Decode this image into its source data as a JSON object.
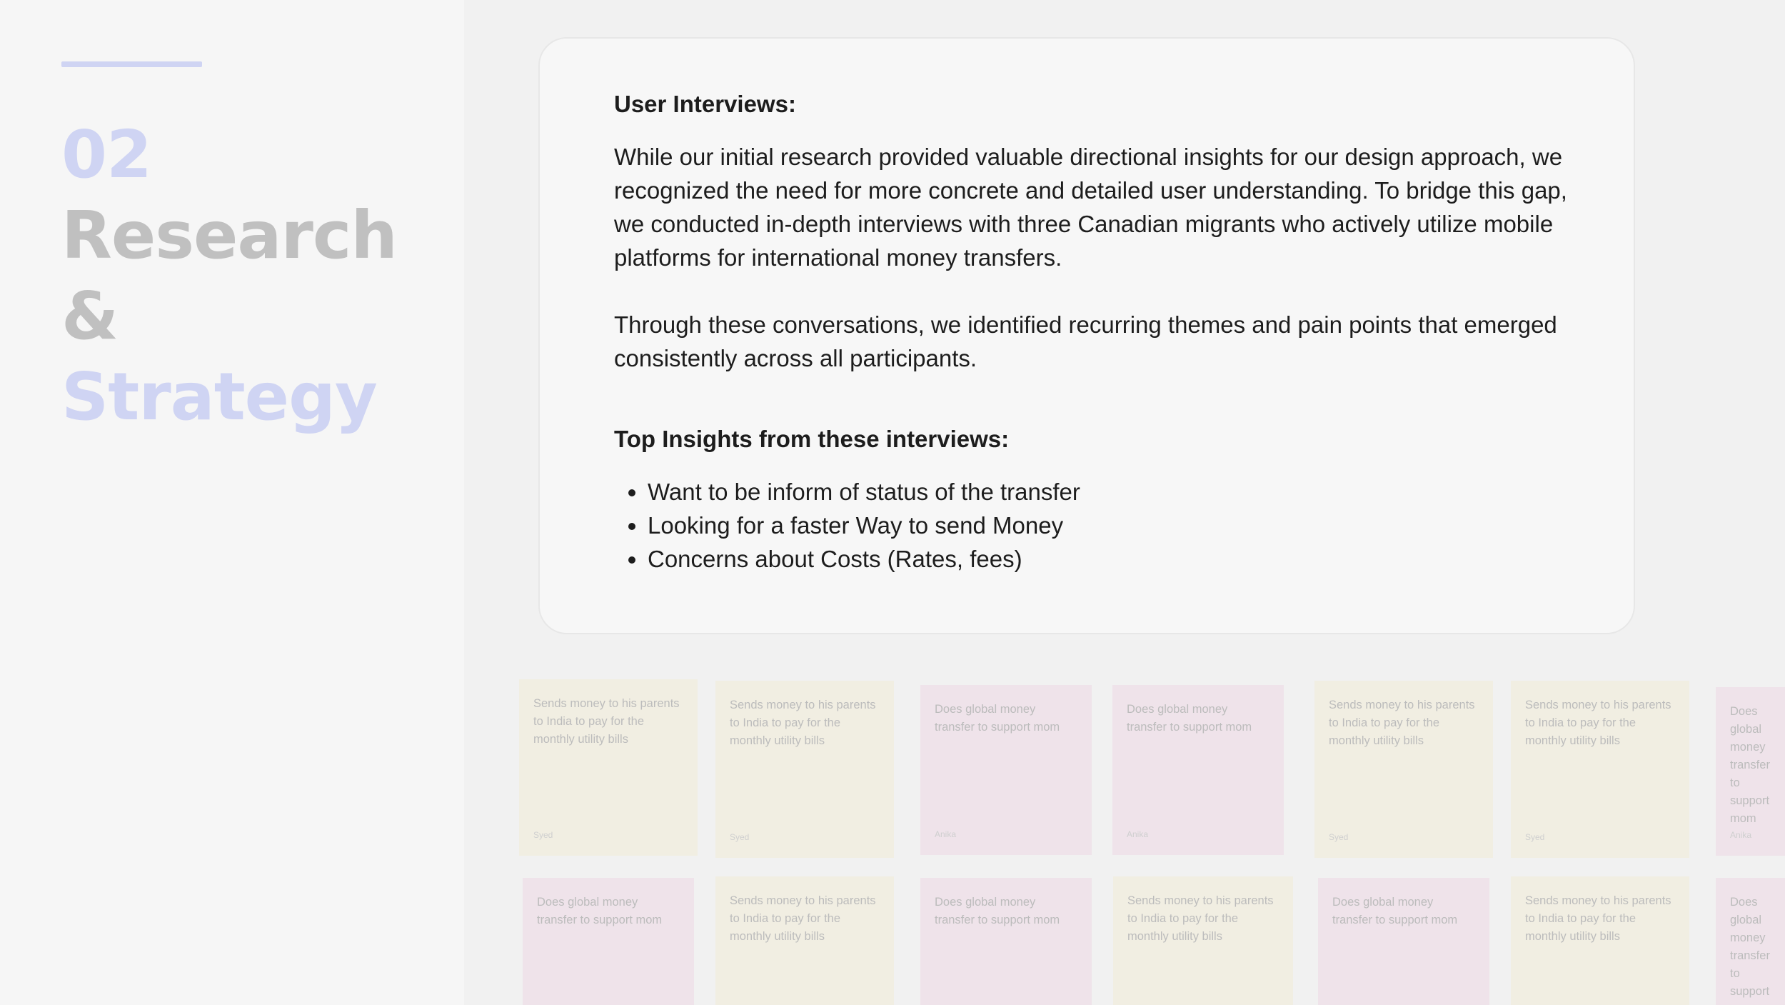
{
  "section": {
    "number": "02",
    "title_line1": "Research",
    "title_line2": "&",
    "title_line3": "Strategy"
  },
  "card": {
    "heading": "User Interviews:",
    "paragraph1": "While our initial research provided valuable directional insights for our design approach, we recognized the need for more concrete and detailed user understanding. To bridge this gap, we conducted in-depth interviews with three Canadian migrants who actively utilize mobile platforms for international money transfers.",
    "paragraph2": "Through these conversations, we identified recurring themes and pain points that emerged consistently across all participants.",
    "insights_heading": "Top Insights from these interviews:",
    "insights": [
      "Want to be inform of status of the transfer",
      "Looking for a faster Way to send Money",
      "Concerns about Costs (Rates, fees)"
    ]
  },
  "notes": {
    "row1": [
      {
        "text": "Sends money to his parents to India to pay for the monthly utility bills",
        "author": "Syed",
        "color": "#f1eee2"
      },
      {
        "text": "Sends money to his parents to India to pay for the monthly utility bills",
        "author": "Syed",
        "color": "#f1eee2"
      },
      {
        "text": "Does global money transfer to support mom",
        "author": "Anika",
        "color": "#efe3ea"
      },
      {
        "text": "Does global money transfer to support mom",
        "author": "Anika",
        "color": "#efe3ea"
      },
      {
        "text": "Sends money to his parents to India to pay for the monthly utility bills",
        "author": "Syed",
        "color": "#f1eee2"
      },
      {
        "text": "Sends money to his parents to India to pay for the monthly utility bills",
        "author": "Syed",
        "color": "#f1eee2"
      },
      {
        "text": "Does global money transfer to support mom",
        "author": "Anika",
        "color": "#efe3ea"
      }
    ],
    "row2": [
      {
        "text": "Does global money transfer to support mom",
        "color": "#efe3ea"
      },
      {
        "text": "Sends money to his parents to India to pay for the monthly utility bills",
        "color": "#f1eee2"
      },
      {
        "text": "Does global money transfer to support mom",
        "color": "#efe3ea"
      },
      {
        "text": "Sends money to his parents to India to pay for the monthly utility bills",
        "color": "#f1eee2"
      },
      {
        "text": "Does global money transfer to support mom",
        "color": "#efe3ea"
      },
      {
        "text": "Sends money to his parents to India to pay for the monthly utility bills",
        "color": "#f1eee2"
      },
      {
        "text": "Does global money transfer to support mom",
        "color": "#efe3ea"
      }
    ]
  }
}
